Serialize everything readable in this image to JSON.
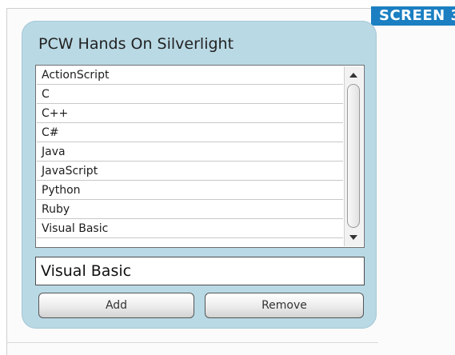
{
  "badge": {
    "label": "SCREEN 3"
  },
  "app": {
    "title": "PCW Hands On Silverlight"
  },
  "list": {
    "items": [
      "ActionScript",
      "C",
      "C++",
      "C#",
      "Java",
      "JavaScript",
      "Python",
      "Ruby",
      "Visual Basic"
    ]
  },
  "textbox": {
    "value": "Visual Basic"
  },
  "buttons": {
    "add_label": "Add",
    "remove_label": "Remove"
  },
  "icons": {
    "scroll_up": "scroll-up-arrow-icon",
    "scroll_down": "scroll-down-arrow-icon"
  },
  "colors": {
    "panel_bg": "#b9d9e5",
    "badge_bg": "#1b7fc2"
  }
}
